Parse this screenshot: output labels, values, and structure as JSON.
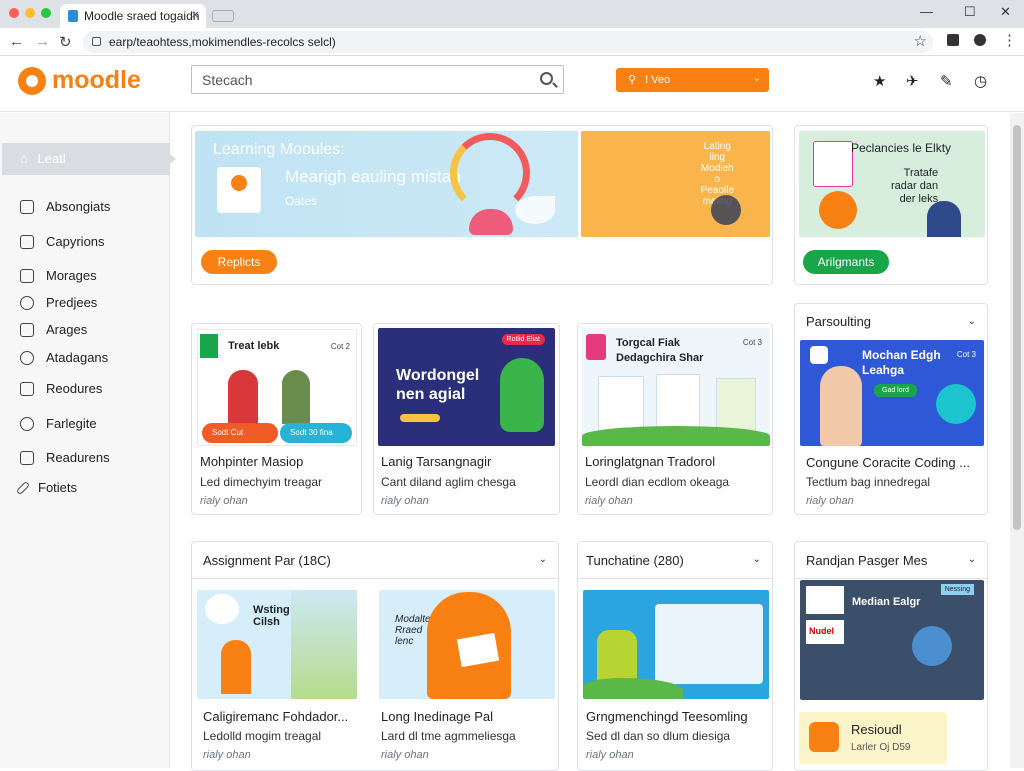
{
  "browser": {
    "tab_title": "Moodle sraed togaidh",
    "url": "earp/teaohtess,mokimendles-recolcs selcl)"
  },
  "header": {
    "logo": "moodle",
    "search_placeholder": "Stecach",
    "select_label": "I Veo"
  },
  "sidebar": {
    "active_item": "Leatl",
    "items": [
      "Absongiats",
      "Capyrions",
      "Morages",
      "Predjees",
      "Arages",
      "Atadagans",
      "Reodures",
      "Farlegite",
      "Readurens",
      "Fotiets"
    ]
  },
  "hero": {
    "title": "Learning Mooules:",
    "subtitle": "Mearigh eauling mistan",
    "caption": "Oates",
    "side_text": "Lating\nling\nModieh\no\nPeaolle\nmeling",
    "button": "Replicts"
  },
  "promo": {
    "title": "Peclancies le Elkty",
    "text": "Tratafe\nradar dan\nder leks",
    "button": "Arilgmants"
  },
  "courses_row1": [
    {
      "thumb_title": "Treat lebk",
      "thumb_badge": "Cot 2",
      "thumb_chip1": "Sodt Cut",
      "thumb_chip2": "Sodt 30 fina",
      "title": "Mohpinter Masiop",
      "sub": "Led dimechyim treagar",
      "meta": "rialy ohan"
    },
    {
      "thumb_title": "Wordongel\nnen agial",
      "thumb_badge": "Rotlid Eliat",
      "title": "Lanig Tarsangnagir",
      "sub": "Cant diland aglim chesga",
      "meta": "rialy ohan"
    },
    {
      "thumb_title": "Torgcal Fiak\nDedagchira Shar",
      "thumb_badge": "Cot 3",
      "title": "Loringlatgnan Tradorol",
      "sub": "Leordl dian ecdlom okeaga",
      "meta": "rialy ohan"
    }
  ],
  "persoulting": {
    "heading": "Parsoulting",
    "thumb_title": "Mochan Edgh\nLeahga",
    "thumb_badge": "Cot 3",
    "thumb_chip": "Gad lord",
    "title": "Congune Coracite Coding ...",
    "sub": "Tectlum bag innedregal",
    "meta": "rialy ohan"
  },
  "section2": {
    "heading": "Assignment Par (18C)",
    "courses": [
      {
        "thumb_title": "Wsting\nCilsh",
        "title": "Caligiremanc Fohdador...",
        "sub": "Ledolld mogim treagal",
        "meta": "rialy ohan"
      },
      {
        "thumb_title": "Modalter\nRraed\nlenc",
        "title": "Long Inedinage Pal",
        "sub": "Lard dl tme agmmeliesga",
        "meta": "rialy ohan"
      }
    ]
  },
  "section3": {
    "heading": "Tunchatine (280)",
    "course": {
      "title": "Grngmenchingd Teesomling",
      "sub": "Sed dl dan so dlum diesiga",
      "meta": "rialy ohan"
    }
  },
  "section4": {
    "heading": "Randjan Pasger Mes",
    "thumb_title": "Median Ealgr",
    "thumb_badge": "Nessing",
    "thumb_chip": "Nudel",
    "resource_title": "Resioudl",
    "resource_sub": "Larler Oj D59"
  },
  "colors": {
    "brand": "#f98012",
    "green": "#19a64a",
    "navy": "#2b2f7a",
    "blue": "#2f58d6"
  }
}
